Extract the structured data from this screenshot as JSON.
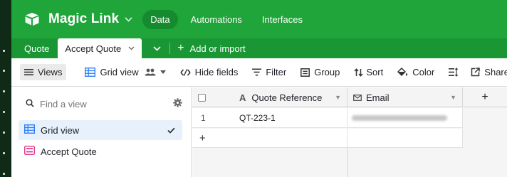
{
  "app": {
    "base_name": "Magic Link",
    "nav": [
      "Data",
      "Automations",
      "Interfaces"
    ]
  },
  "tables": {
    "items": [
      "Quote",
      "Accept Quote"
    ],
    "active": "Accept Quote",
    "add_label": "Add or import"
  },
  "toolbar": {
    "views": "Views",
    "grid_view": "Grid view",
    "hide_fields": "Hide fields",
    "filter": "Filter",
    "group": "Group",
    "sort": "Sort",
    "color": "Color",
    "share": "Share view"
  },
  "sidebar": {
    "search_placeholder": "Find a view",
    "views": [
      {
        "label": "Grid view",
        "type": "grid",
        "selected": true
      },
      {
        "label": "Accept Quote",
        "type": "form",
        "selected": false
      }
    ]
  },
  "grid": {
    "columns": [
      {
        "label": "Quote Reference",
        "type": "text"
      },
      {
        "label": "Email",
        "type": "email"
      }
    ],
    "add_field": "+",
    "rows": [
      {
        "num": "1",
        "quote_reference": "QT-223-1"
      }
    ],
    "add_row": "+"
  },
  "colors": {
    "header_green": "#1fa53a",
    "tables_bar_green": "#1a9634",
    "grid_view_blue": "#2d7ff9",
    "form_pink": "#e23a8a",
    "selected_view_bg": "#e6f1fb"
  }
}
